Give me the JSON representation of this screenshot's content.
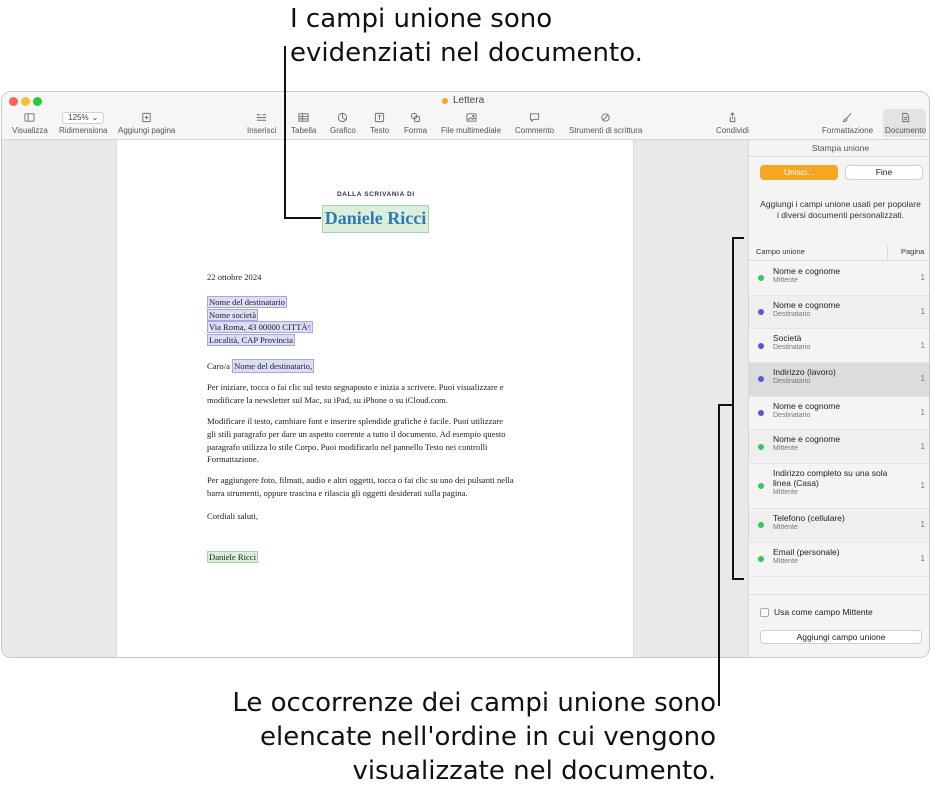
{
  "callouts": {
    "top": [
      "I campi unione sono",
      "evidenziati nel documento."
    ],
    "bottom": [
      "Le occorrenze dei campi unione sono",
      "elencate nell'ordine in cui vengono",
      "visualizzate nel documento."
    ]
  },
  "window": {
    "title": "Lettera",
    "zoom": "125%"
  },
  "toolbar": {
    "view": "Visualizza",
    "resize": "Ridimensiona",
    "add_page": "Aggiungi pagina",
    "insert": "Inserisci",
    "table": "Tabella",
    "chart": "Grafico",
    "text": "Testo",
    "shape": "Forma",
    "media": "File multimediale",
    "comment": "Commento",
    "writing_tools": "Strumenti di scrittura",
    "share": "Condividi",
    "format": "Formattazione",
    "document": "Documento"
  },
  "letter": {
    "from_label": "DALLA SCRIVANIA DI",
    "sender_name": "Daniele Ricci",
    "date": "22 ottobre 2024",
    "recipient_name": "Nome del destinatario",
    "company": "Nome società",
    "address": "Via Roma, 43 00000 CITTÀ",
    "locality": "Località, CAP Provincia",
    "salutation_prefix": "Caro/a",
    "salutation_field": "Nome del destinatario,",
    "para1": [
      "Per iniziare, tocca o fai clic sul testo segnaposto e inizia a scrivere. Puoi visualizzare e",
      "modificare la newsletter sul Mac, su iPad, su iPhone o su iCloud.com."
    ],
    "para2": [
      "Modificare il testo, cambiare font e inserire splendide grafiche è facile. Puoi utilizzare",
      "gli stili paragrafo per dare un aspetto coerente a tutto il documento. Ad esempio questo",
      "paragrafo utilizza lo stile Corpo. Puoi modificarlo nel pannello Testo nei controlli",
      "Formattazione."
    ],
    "para3": [
      "Per aggiungere foto, filmati, audio e altri oggetti, tocca o fai clic su uno dei pulsanti nella",
      "barra strumenti, oppure trascina e rilascia gli oggetti desiderati sulla pagina."
    ],
    "closing": "Cordiali saluti,",
    "signature": "Daniele Ricci"
  },
  "sidebar": {
    "title": "Stampa unione",
    "merge_button": "Unisci...",
    "done_button": "Fine",
    "description": "Aggiungi i campi unione usati per popolare i diversi documenti personalizzati.",
    "col_field": "Campo unione",
    "col_page": "Pagina",
    "fields": [
      {
        "name": "Nome e cognome",
        "source": "Mittente",
        "page": "1",
        "color": "#34c759"
      },
      {
        "name": "Nome e cognome",
        "source": "Destinatario",
        "page": "1",
        "color": "#5856d6"
      },
      {
        "name": "Società",
        "source": "Destinatario",
        "page": "1",
        "color": "#5856d6"
      },
      {
        "name": "Indirizzo (lavoro)",
        "source": "Destinatario",
        "page": "1",
        "color": "#5856d6"
      },
      {
        "name": "Nome e cognome",
        "source": "Destinatario",
        "page": "1",
        "color": "#5856d6"
      },
      {
        "name": "Nome e cognome",
        "source": "Mittente",
        "page": "1",
        "color": "#34c759"
      },
      {
        "name": "Indirizzo completo su una sola linea (Casa)",
        "source": "Mittente",
        "page": "1",
        "color": "#34c759"
      },
      {
        "name": "Telefono (cellulare)",
        "source": "Mittente",
        "page": "1",
        "color": "#34c759"
      },
      {
        "name": "Email (personale)",
        "source": "Mittente",
        "page": "1",
        "color": "#34c759"
      }
    ],
    "use_as_sender": "Usa come campo Mittente",
    "add_field_button": "Aggiungi campo unione"
  }
}
